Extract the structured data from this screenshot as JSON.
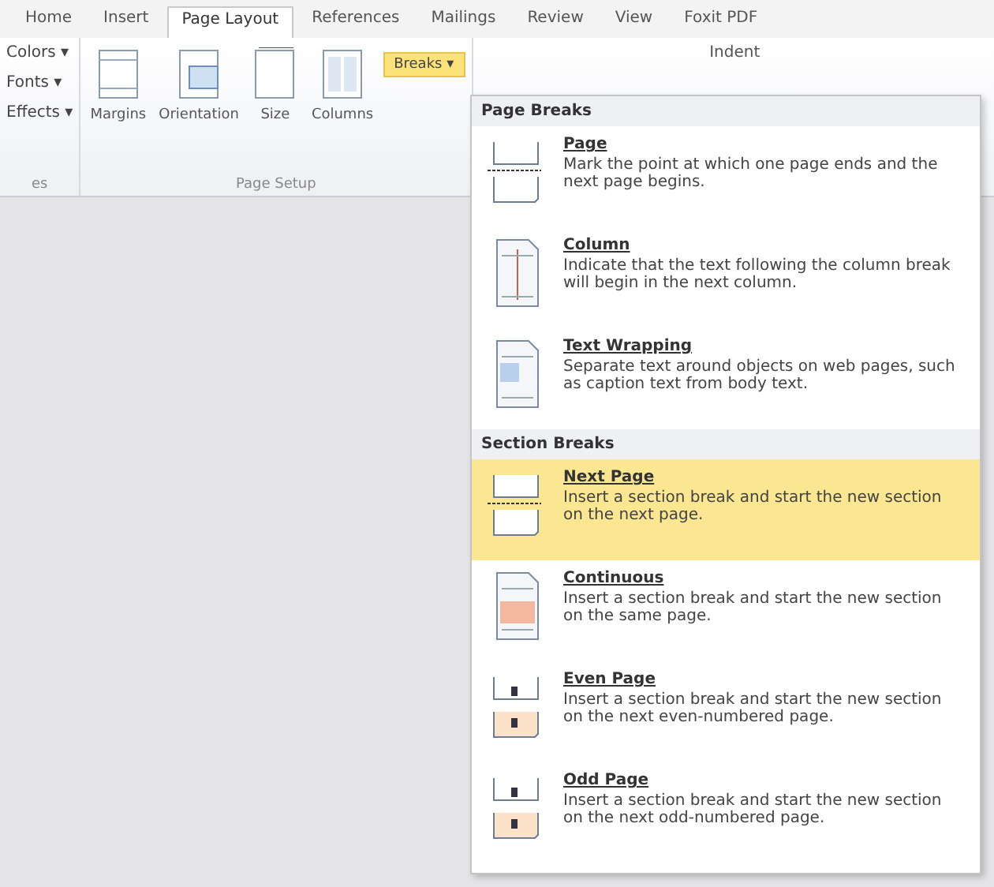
{
  "tabs": [
    {
      "label": "Home",
      "selected": false
    },
    {
      "label": "Insert",
      "selected": false
    },
    {
      "label": "Page Layout",
      "selected": true
    },
    {
      "label": "References",
      "selected": false
    },
    {
      "label": "Mailings",
      "selected": false
    },
    {
      "label": "Review",
      "selected": false
    },
    {
      "label": "View",
      "selected": false
    },
    {
      "label": "Foxit PDF",
      "selected": false
    }
  ],
  "themes_group": {
    "items": [
      "Colors ▾",
      "Fonts ▾",
      "Effects ▾"
    ],
    "label": "es"
  },
  "page_setup": {
    "buttons": [
      {
        "label": "Margins",
        "kind": "margins"
      },
      {
        "label": "Orientation",
        "kind": "orientation"
      },
      {
        "label": "Size",
        "kind": "size"
      },
      {
        "label": "Columns",
        "kind": "columns"
      }
    ],
    "breaks": "Breaks ▾",
    "label": "Page Setup"
  },
  "indent_label": "Indent",
  "menu": {
    "sections": [
      {
        "title": "Page Breaks",
        "items": [
          {
            "name": "Page",
            "description": "Mark the point at which one page ends and the next page begins.",
            "kind": "page",
            "selected": false
          },
          {
            "name": "Column",
            "description": "Indicate that the text following the column break will begin in the next column.",
            "kind": "column",
            "selected": false
          },
          {
            "name": "Text Wrapping",
            "description": "Separate text around objects on web pages, such as caption text from body text.",
            "kind": "wrap",
            "selected": false
          }
        ]
      },
      {
        "title": "Section Breaks",
        "items": [
          {
            "name": "Next Page",
            "description": "Insert a section break and start the new section on the next page.",
            "kind": "page",
            "selected": true
          },
          {
            "name": "Continuous",
            "description": "Insert a section break and start the new section on the same page.",
            "kind": "continuous",
            "selected": false
          },
          {
            "name": "Even Page",
            "description": "Insert a section break and start the new section on the next even-numbered page.",
            "kind": "numbered",
            "selected": false
          },
          {
            "name": "Odd Page",
            "description": "Insert a section break and start the new section on the next odd-numbered page.",
            "kind": "numbered",
            "selected": false
          }
        ]
      }
    ]
  }
}
